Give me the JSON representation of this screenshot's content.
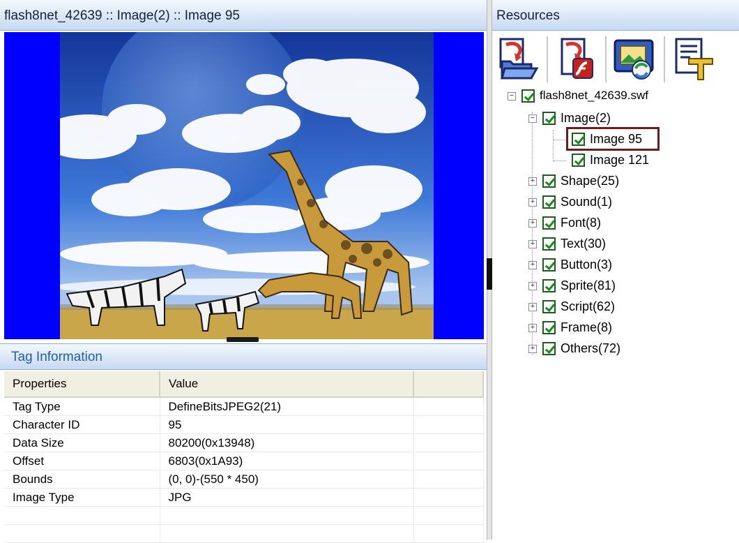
{
  "left_pane": {
    "title": "flash8net_42639 :: Image(2) :: Image 95"
  },
  "tag_info": {
    "title": "Tag Information",
    "columns": [
      "Properties",
      "Value",
      ""
    ],
    "rows": [
      {
        "property": "Tag Type",
        "value": "DefineBitsJPEG2(21)"
      },
      {
        "property": "Character ID",
        "value": "95"
      },
      {
        "property": "Data Size",
        "value": "80200(0x13948)"
      },
      {
        "property": "Offset",
        "value": "6803(0x1A93)"
      },
      {
        "property": "Bounds",
        "value": "(0, 0)-(550 * 450)"
      },
      {
        "property": "Image Type",
        "value": "JPG"
      },
      {
        "property": "",
        "value": ""
      },
      {
        "property": "",
        "value": ""
      }
    ]
  },
  "right_pane": {
    "title": "Resources",
    "toolbar": [
      "open-folder-icon",
      "export-flash-icon",
      "replace-image-icon",
      "font-text-icon"
    ],
    "tree": {
      "root": "flash8net_42639.swf",
      "image_group": "Image(2)",
      "images": [
        "Image 95",
        "Image 121"
      ],
      "selected": "Image 95",
      "groups": [
        "Shape(25)",
        "Sound(1)",
        "Font(8)",
        "Text(30)",
        "Button(3)",
        "Sprite(81)",
        "Script(62)",
        "Frame(8)",
        "Others(72)"
      ]
    }
  },
  "colors": {
    "preview_background": "#0000ff",
    "panel_title_gradient": "#c7d9f1",
    "selection_border": "#6b1d1d",
    "check_color": "#1a8a1a"
  }
}
